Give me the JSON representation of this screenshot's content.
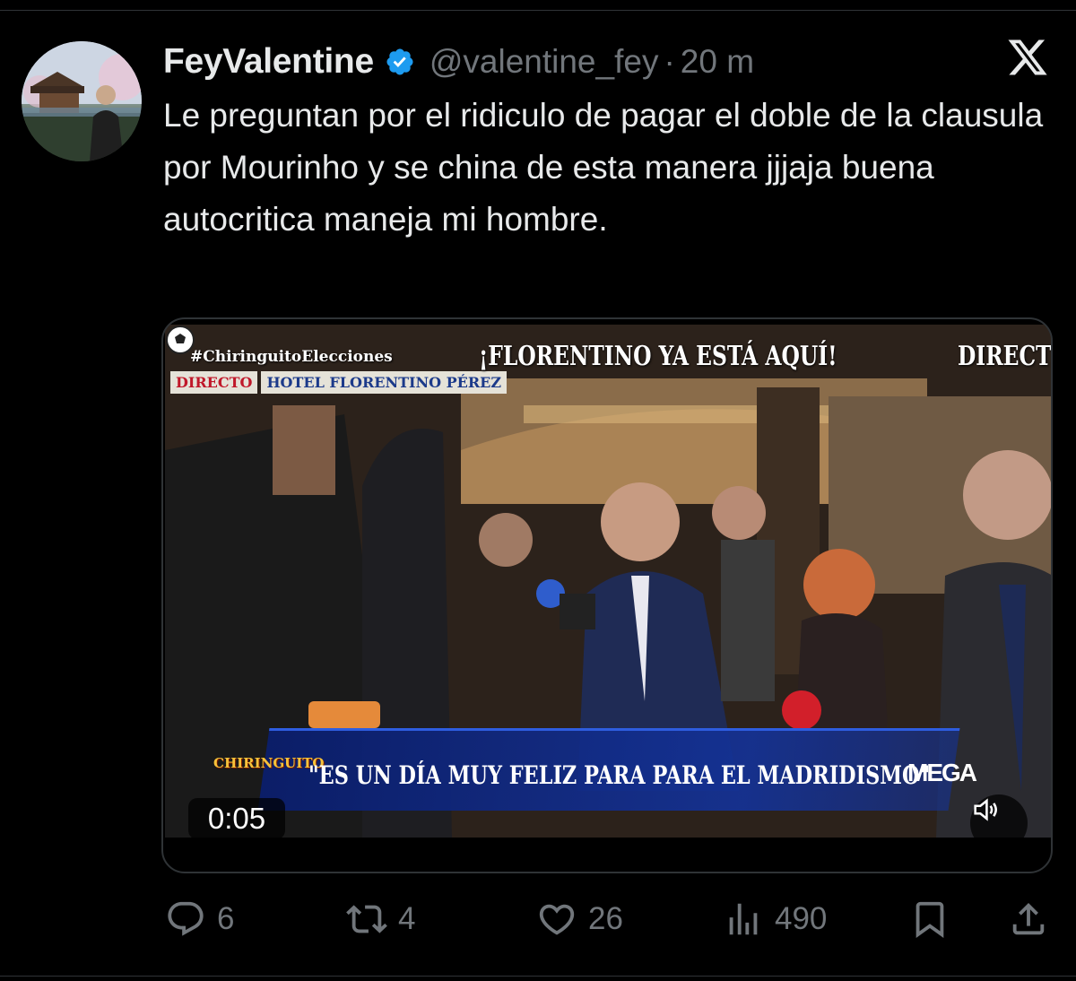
{
  "tweet": {
    "display_name": "FeyValentine",
    "handle": "@valentine_fey",
    "separator": "·",
    "time": "20 m",
    "text": "Le preguntan por el ridiculo de pagar el doble de la clausula por Mourinho y se china de esta manera jjjaja buena autocritica maneja mi hombre.",
    "verified_icon": "verified-badge-icon",
    "brand_icon": "x-logo-icon"
  },
  "video": {
    "hashtag": "#ChiringuitoElecciones",
    "live_label": "DIRECTO",
    "location_label": "HOTEL FLORENTINO PÉREZ",
    "headline": "¡FLORENTINO YA ESTÁ AQUÍ!",
    "headline_right": "DIRECT",
    "show_logo": "CHIRINGUITO",
    "quote": "\"ES UN DÍA MUY FELIZ PARA PARA EL MADRIDISMO\"",
    "channel": "MEGA",
    "timestamp": "0:05"
  },
  "actions": {
    "replies": "6",
    "reposts": "4",
    "likes": "26",
    "views": "490"
  },
  "colors": {
    "background": "#000000",
    "text": "#e7e9ea",
    "muted": "#71767b",
    "verified": "#1d9bf0",
    "border": "#2f3336"
  }
}
